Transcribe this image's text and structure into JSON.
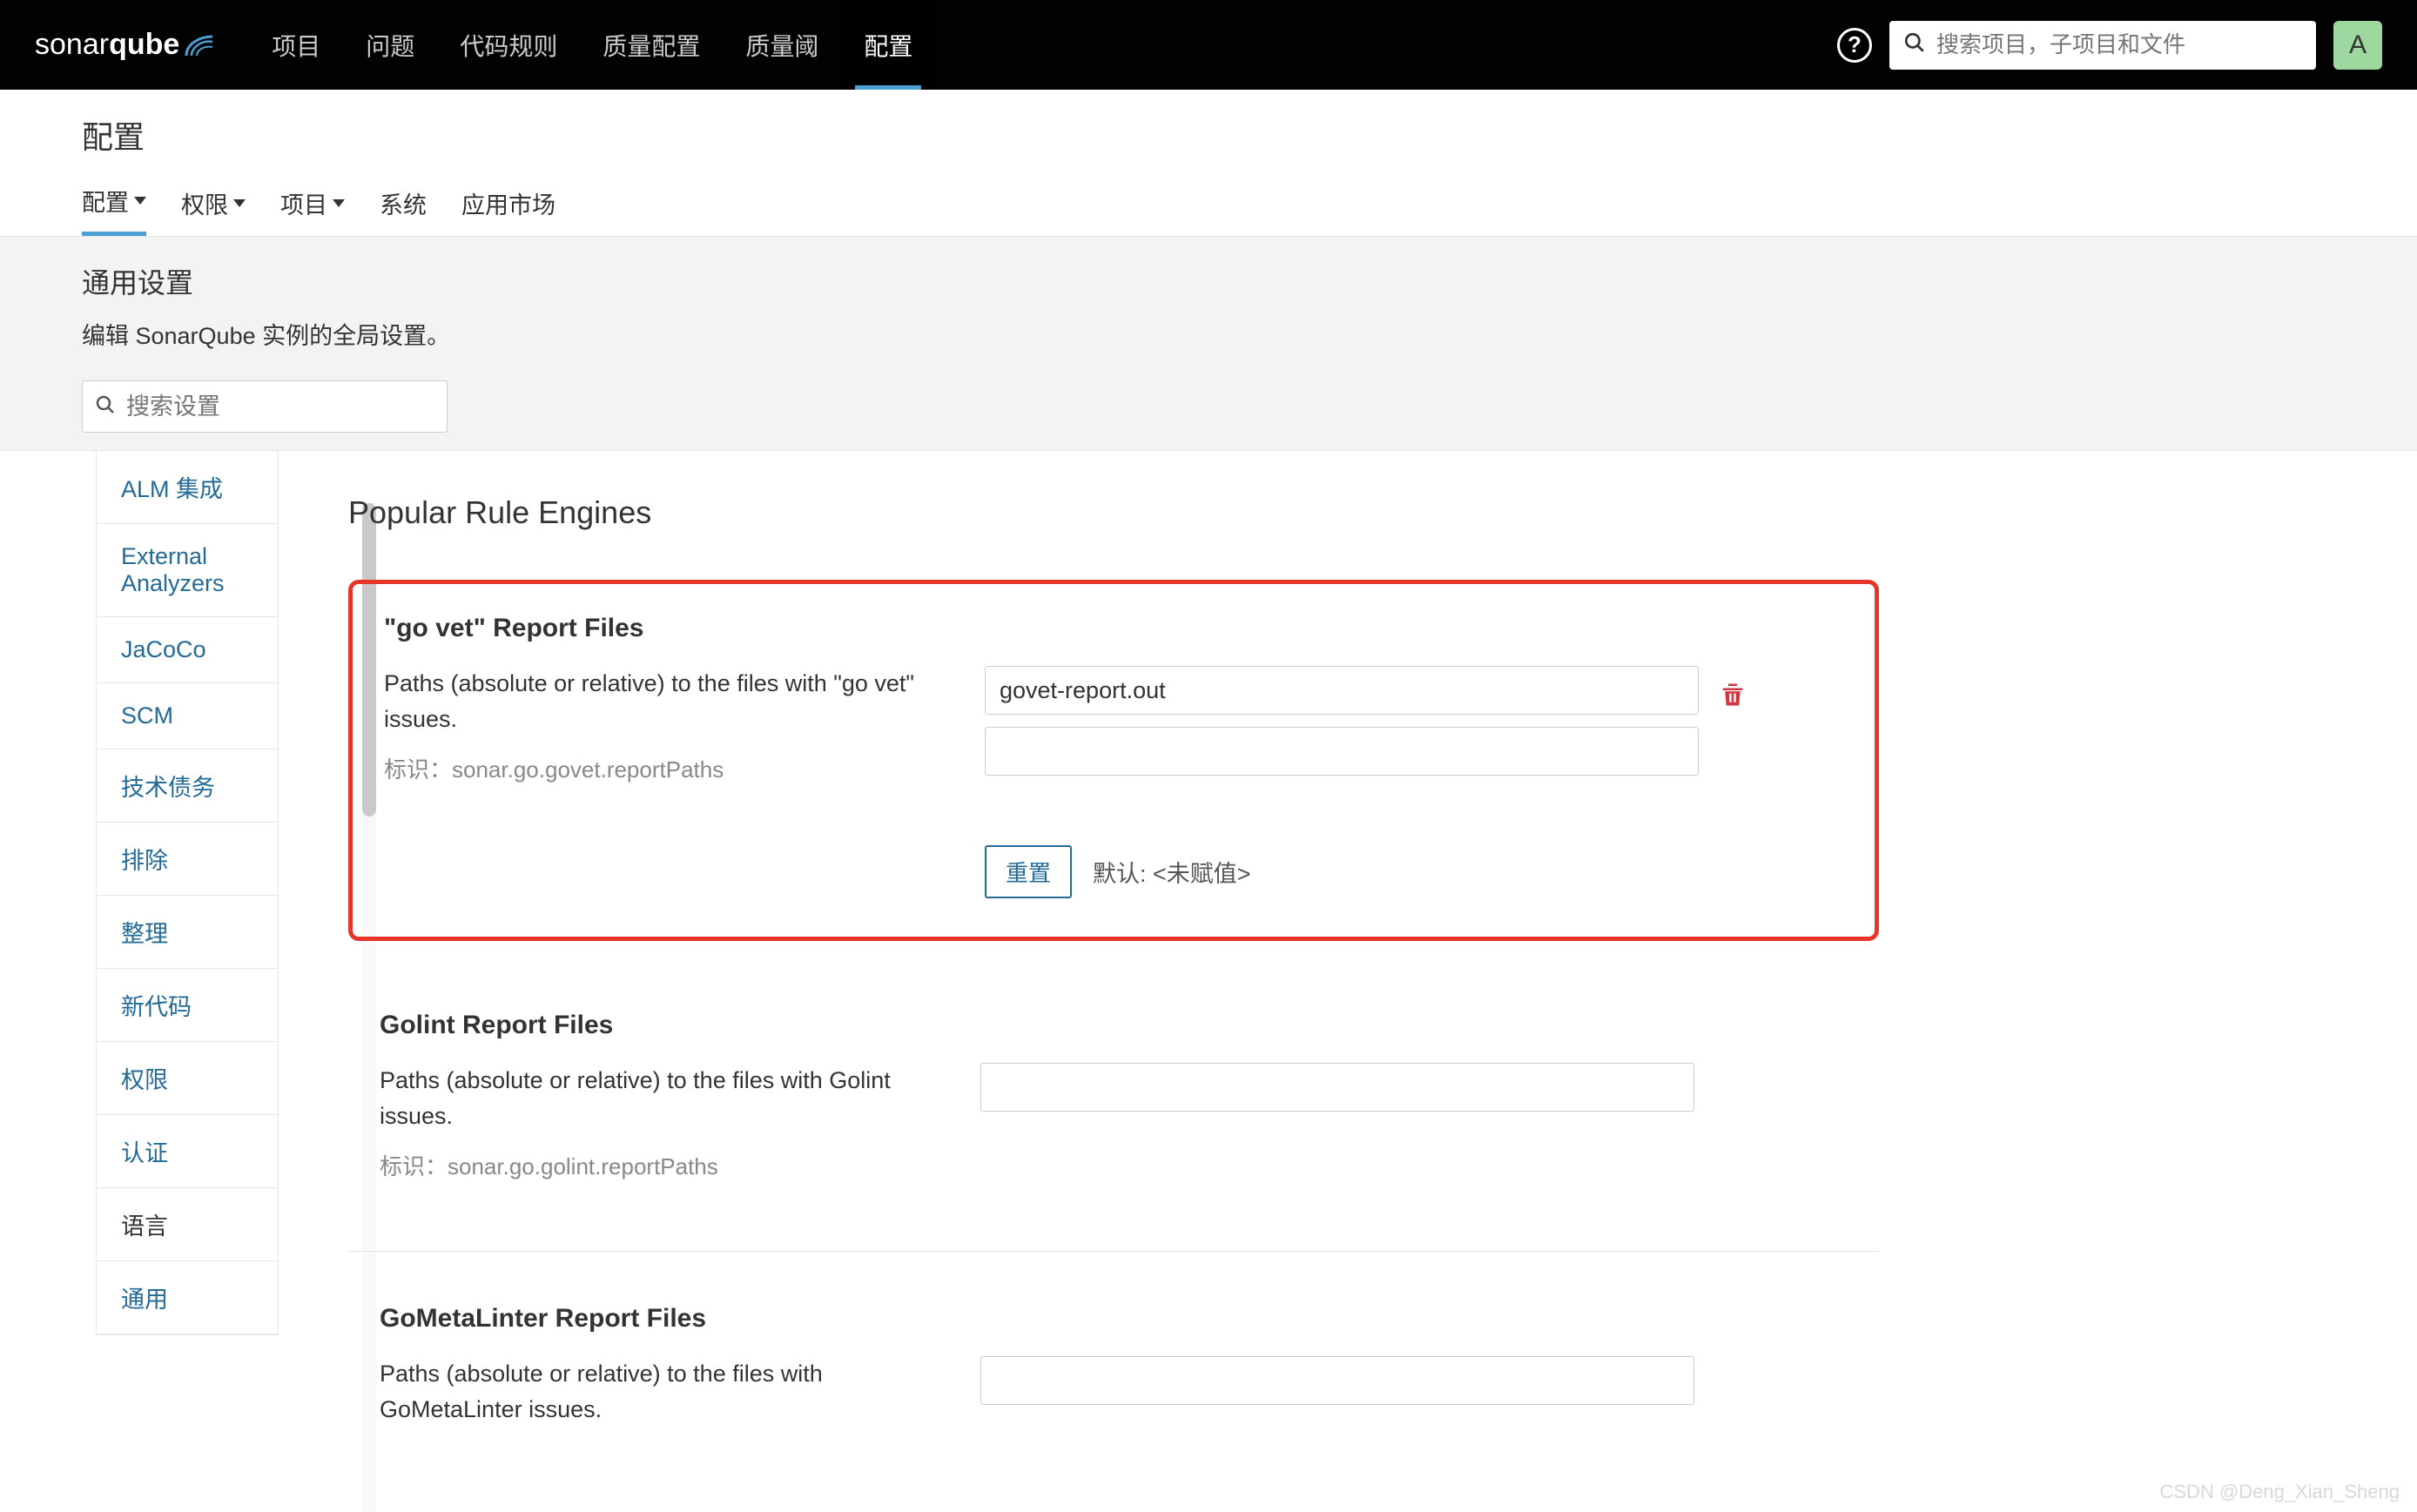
{
  "brand": {
    "part1": "sonar",
    "part2": "qube"
  },
  "topnav": {
    "items": [
      "项目",
      "问题",
      "代码规则",
      "质量配置",
      "质量阈",
      "配置"
    ],
    "active_index": 5,
    "search_placeholder": "搜索项目，子项目和文件",
    "avatar_letter": "A",
    "help_symbol": "?"
  },
  "subheader": {
    "title": "配置",
    "tabs": [
      {
        "label": "配置",
        "caret": true,
        "active": true
      },
      {
        "label": "权限",
        "caret": true,
        "active": false
      },
      {
        "label": "项目",
        "caret": true,
        "active": false
      },
      {
        "label": "系统",
        "caret": false,
        "active": false
      },
      {
        "label": "应用市场",
        "caret": false,
        "active": false
      }
    ]
  },
  "context": {
    "heading": "通用设置",
    "description": "编辑 SonarQube 实例的全局设置。",
    "search_placeholder": "搜索设置"
  },
  "sidebar": {
    "items": [
      {
        "label": "ALM 集成",
        "active": false,
        "link": true
      },
      {
        "label": "External Analyzers",
        "active": false,
        "link": true
      },
      {
        "label": "JaCoCo",
        "active": false,
        "link": true
      },
      {
        "label": "SCM",
        "active": false,
        "link": true
      },
      {
        "label": "技术债务",
        "active": false,
        "link": true
      },
      {
        "label": "排除",
        "active": false,
        "link": true
      },
      {
        "label": "整理",
        "active": false,
        "link": true
      },
      {
        "label": "新代码",
        "active": false,
        "link": true
      },
      {
        "label": "权限",
        "active": false,
        "link": true
      },
      {
        "label": "认证",
        "active": false,
        "link": true
      },
      {
        "label": "语言",
        "active": true,
        "link": false
      },
      {
        "label": "通用",
        "active": false,
        "link": true
      }
    ]
  },
  "main": {
    "section_title": "Popular Rule Engines",
    "govet": {
      "title": "\"go vet\" Report Files",
      "description": "Paths (absolute or relative) to the files with \"go vet\" issues.",
      "key_label": "标识：",
      "key_value": "sonar.go.govet.reportPaths",
      "input_value": "govet-report.out",
      "reset_label": "重置",
      "default_label": "默认: <未赋值>"
    },
    "golint": {
      "title": "Golint Report Files",
      "description": "Paths (absolute or relative) to the files with Golint issues.",
      "key_label": "标识：",
      "key_value": "sonar.go.golint.reportPaths"
    },
    "gometalinter": {
      "title": "GoMetaLinter Report Files",
      "description": "Paths (absolute or relative) to the files with GoMetaLinter issues."
    }
  },
  "watermark": "CSDN @Deng_Xian_Sheng"
}
